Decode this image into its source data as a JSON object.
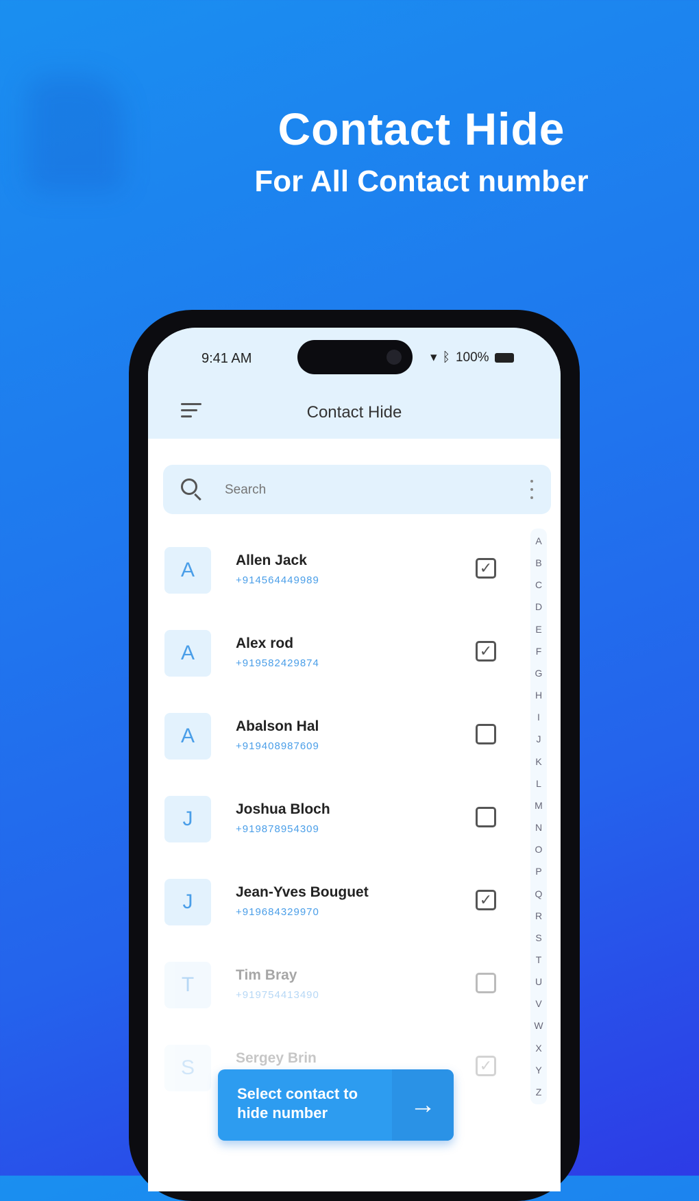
{
  "hero": {
    "title": "Contact Hide",
    "subtitle": "For All Contact number"
  },
  "status_bar": {
    "time": "9:41 AM",
    "battery": "100%"
  },
  "app_bar": {
    "title": "Contact Hide",
    "menu_icon": "menu-icon"
  },
  "search": {
    "placeholder": "Search",
    "icon": "search-icon",
    "more_icon": "more-vertical-icon"
  },
  "contacts": [
    {
      "initial": "A",
      "name": "Allen Jack",
      "phone": "+914564449989",
      "checked": true
    },
    {
      "initial": "A",
      "name": "Alex rod",
      "phone": "+919582429874",
      "checked": true
    },
    {
      "initial": "A",
      "name": "Abalson Hal",
      "phone": "+919408987609",
      "checked": false
    },
    {
      "initial": "J",
      "name": "Joshua Bloch",
      "phone": "+919878954309",
      "checked": false
    },
    {
      "initial": "J",
      "name": "Jean-Yves Bouguet",
      "phone": "+919684329970",
      "checked": true
    },
    {
      "initial": "T",
      "name": "Tim Bray",
      "phone": "+919754413490",
      "checked": false
    },
    {
      "initial": "S",
      "name": "Sergey Brin",
      "phone": "",
      "checked": true
    }
  ],
  "alphabet": [
    "A",
    "B",
    "C",
    "D",
    "E",
    "F",
    "G",
    "H",
    "I",
    "J",
    "K",
    "L",
    "M",
    "N",
    "O",
    "P",
    "Q",
    "R",
    "S",
    "T",
    "U",
    "V",
    "W",
    "X",
    "Y",
    "Z"
  ],
  "cta": {
    "label": "Select contact to hide number",
    "icon": "arrow-right-icon"
  },
  "colors": {
    "accent": "#2d9cf0",
    "screen_tint": "#e3f2fd",
    "background_start": "#1a8ff0",
    "background_end": "#2d3be6"
  }
}
